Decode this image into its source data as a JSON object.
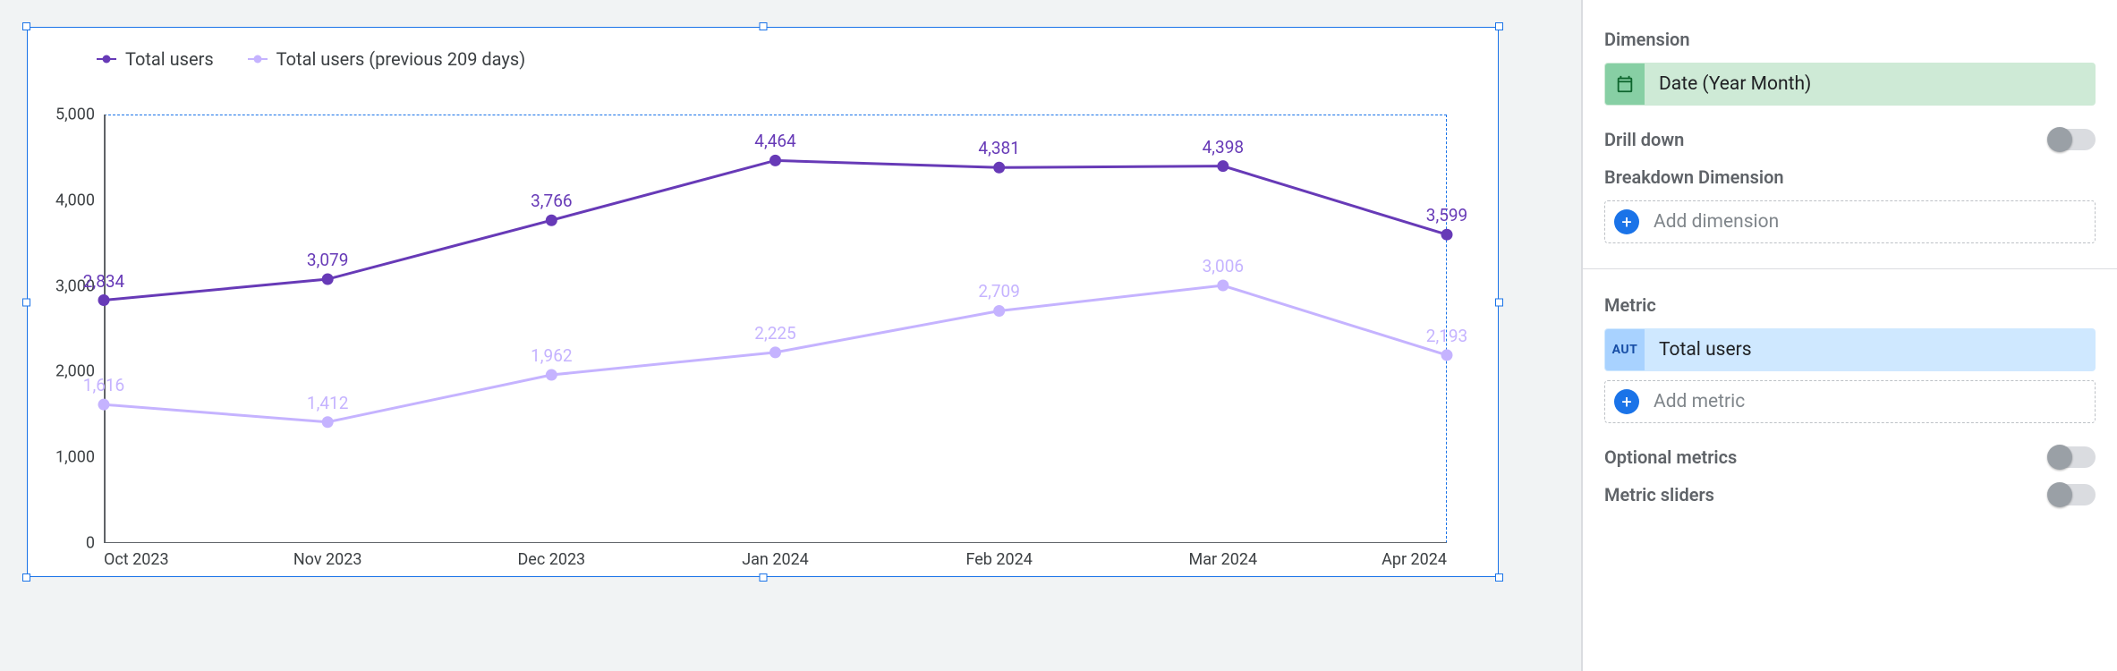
{
  "chart_data": {
    "type": "line",
    "title": "",
    "xlabel": "",
    "ylabel": "",
    "ylim": [
      0,
      5000
    ],
    "yticks": [
      0,
      1000,
      2000,
      3000,
      4000,
      5000
    ],
    "ytick_labels": [
      "0",
      "1,000",
      "2,000",
      "3,000",
      "4,000",
      "5,000"
    ],
    "categories": [
      "Oct 2023",
      "Nov 2023",
      "Dec 2023",
      "Jan 2024",
      "Feb 2024",
      "Mar 2024",
      "Apr 2024"
    ],
    "series": [
      {
        "name": "Total users",
        "color": "#673ab7",
        "values": [
          2834,
          3079,
          3766,
          4464,
          4381,
          4398,
          3599
        ],
        "labels": [
          "2,834",
          "3,079",
          "3,766",
          "4,464",
          "4,381",
          "4,398",
          "3,599"
        ]
      },
      {
        "name": "Total users (previous 209 days)",
        "color": "#c5b3ff",
        "values": [
          1616,
          1412,
          1962,
          2225,
          2709,
          3006,
          2193
        ],
        "labels": [
          "1,616",
          "1,412",
          "1,962",
          "2,225",
          "2,709",
          "3,006",
          "2,193"
        ]
      }
    ],
    "legend_position": "top-left",
    "grid": false
  },
  "panel": {
    "dimension_label": "Dimension",
    "dimension_chip": "Date (Year Month)",
    "drilldown_label": "Drill down",
    "drilldown_on": false,
    "breakdown_label": "Breakdown Dimension",
    "add_dimension": "Add dimension",
    "metric_label": "Metric",
    "metric_chip_prefix": "AUT",
    "metric_chip": "Total users",
    "add_metric": "Add metric",
    "optional_metrics_label": "Optional metrics",
    "optional_metrics_on": false,
    "metric_sliders_label": "Metric sliders",
    "metric_sliders_on": false
  }
}
